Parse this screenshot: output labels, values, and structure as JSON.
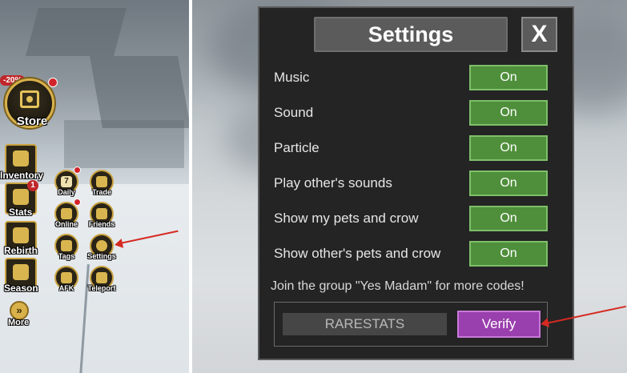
{
  "hud": {
    "store_label": "Store",
    "discount": "-20%",
    "buttons": {
      "inventory": "Inventory",
      "stats": "Stats",
      "stats_badge": "1",
      "rebirth": "Rebirth",
      "season": "Season",
      "more": "More",
      "daily": "Daily",
      "daily_day": "7",
      "trade": "Trade",
      "online": "Online",
      "friends": "Friends",
      "tags": "Tags",
      "settings": "Settings",
      "afk": "AFK",
      "teleport": "Teleport"
    }
  },
  "settings_dialog": {
    "title": "Settings",
    "close_label": "X",
    "rows": [
      {
        "label": "Music",
        "state": "On"
      },
      {
        "label": "Sound",
        "state": "On"
      },
      {
        "label": "Particle",
        "state": "On"
      },
      {
        "label": "Play other's sounds",
        "state": "On"
      },
      {
        "label": "Show my pets and crow",
        "state": "On"
      },
      {
        "label": "Show other's pets and crow",
        "state": "On"
      }
    ],
    "group_note": "Join the group \"Yes Madam\" for more codes!",
    "code_value": "RARESTATS",
    "verify_label": "Verify"
  },
  "colors": {
    "toggle_on": "#4f8f3b",
    "verify": "#9a3fae",
    "dialog_bg": "#242424",
    "arrow": "#d52a22",
    "gold": "#c9a340"
  },
  "icons": [
    "store-icon",
    "inventory-icon",
    "stats-icon",
    "rebirth-icon",
    "season-icon",
    "more-icon",
    "daily-calendar-icon",
    "trade-icon",
    "online-icon",
    "friends-icon",
    "tags-icon",
    "settings-gear-icon",
    "afk-icon",
    "teleport-icon",
    "close-icon"
  ]
}
